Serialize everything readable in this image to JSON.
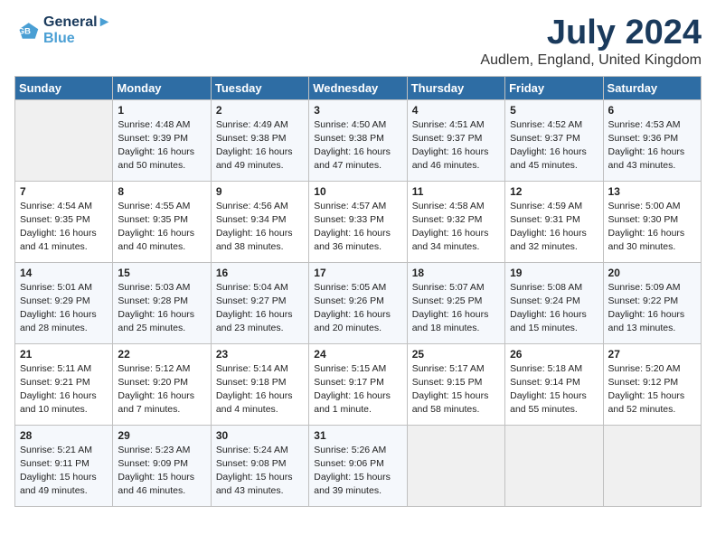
{
  "logo": {
    "line1": "General",
    "line2": "Blue"
  },
  "title": "July 2024",
  "location": "Audlem, England, United Kingdom",
  "days_header": [
    "Sunday",
    "Monday",
    "Tuesday",
    "Wednesday",
    "Thursday",
    "Friday",
    "Saturday"
  ],
  "weeks": [
    [
      {
        "day": "",
        "info": ""
      },
      {
        "day": "1",
        "info": "Sunrise: 4:48 AM\nSunset: 9:39 PM\nDaylight: 16 hours\nand 50 minutes."
      },
      {
        "day": "2",
        "info": "Sunrise: 4:49 AM\nSunset: 9:38 PM\nDaylight: 16 hours\nand 49 minutes."
      },
      {
        "day": "3",
        "info": "Sunrise: 4:50 AM\nSunset: 9:38 PM\nDaylight: 16 hours\nand 47 minutes."
      },
      {
        "day": "4",
        "info": "Sunrise: 4:51 AM\nSunset: 9:37 PM\nDaylight: 16 hours\nand 46 minutes."
      },
      {
        "day": "5",
        "info": "Sunrise: 4:52 AM\nSunset: 9:37 PM\nDaylight: 16 hours\nand 45 minutes."
      },
      {
        "day": "6",
        "info": "Sunrise: 4:53 AM\nSunset: 9:36 PM\nDaylight: 16 hours\nand 43 minutes."
      }
    ],
    [
      {
        "day": "7",
        "info": "Sunrise: 4:54 AM\nSunset: 9:35 PM\nDaylight: 16 hours\nand 41 minutes."
      },
      {
        "day": "8",
        "info": "Sunrise: 4:55 AM\nSunset: 9:35 PM\nDaylight: 16 hours\nand 40 minutes."
      },
      {
        "day": "9",
        "info": "Sunrise: 4:56 AM\nSunset: 9:34 PM\nDaylight: 16 hours\nand 38 minutes."
      },
      {
        "day": "10",
        "info": "Sunrise: 4:57 AM\nSunset: 9:33 PM\nDaylight: 16 hours\nand 36 minutes."
      },
      {
        "day": "11",
        "info": "Sunrise: 4:58 AM\nSunset: 9:32 PM\nDaylight: 16 hours\nand 34 minutes."
      },
      {
        "day": "12",
        "info": "Sunrise: 4:59 AM\nSunset: 9:31 PM\nDaylight: 16 hours\nand 32 minutes."
      },
      {
        "day": "13",
        "info": "Sunrise: 5:00 AM\nSunset: 9:30 PM\nDaylight: 16 hours\nand 30 minutes."
      }
    ],
    [
      {
        "day": "14",
        "info": "Sunrise: 5:01 AM\nSunset: 9:29 PM\nDaylight: 16 hours\nand 28 minutes."
      },
      {
        "day": "15",
        "info": "Sunrise: 5:03 AM\nSunset: 9:28 PM\nDaylight: 16 hours\nand 25 minutes."
      },
      {
        "day": "16",
        "info": "Sunrise: 5:04 AM\nSunset: 9:27 PM\nDaylight: 16 hours\nand 23 minutes."
      },
      {
        "day": "17",
        "info": "Sunrise: 5:05 AM\nSunset: 9:26 PM\nDaylight: 16 hours\nand 20 minutes."
      },
      {
        "day": "18",
        "info": "Sunrise: 5:07 AM\nSunset: 9:25 PM\nDaylight: 16 hours\nand 18 minutes."
      },
      {
        "day": "19",
        "info": "Sunrise: 5:08 AM\nSunset: 9:24 PM\nDaylight: 16 hours\nand 15 minutes."
      },
      {
        "day": "20",
        "info": "Sunrise: 5:09 AM\nSunset: 9:22 PM\nDaylight: 16 hours\nand 13 minutes."
      }
    ],
    [
      {
        "day": "21",
        "info": "Sunrise: 5:11 AM\nSunset: 9:21 PM\nDaylight: 16 hours\nand 10 minutes."
      },
      {
        "day": "22",
        "info": "Sunrise: 5:12 AM\nSunset: 9:20 PM\nDaylight: 16 hours\nand 7 minutes."
      },
      {
        "day": "23",
        "info": "Sunrise: 5:14 AM\nSunset: 9:18 PM\nDaylight: 16 hours\nand 4 minutes."
      },
      {
        "day": "24",
        "info": "Sunrise: 5:15 AM\nSunset: 9:17 PM\nDaylight: 16 hours\nand 1 minute."
      },
      {
        "day": "25",
        "info": "Sunrise: 5:17 AM\nSunset: 9:15 PM\nDaylight: 15 hours\nand 58 minutes."
      },
      {
        "day": "26",
        "info": "Sunrise: 5:18 AM\nSunset: 9:14 PM\nDaylight: 15 hours\nand 55 minutes."
      },
      {
        "day": "27",
        "info": "Sunrise: 5:20 AM\nSunset: 9:12 PM\nDaylight: 15 hours\nand 52 minutes."
      }
    ],
    [
      {
        "day": "28",
        "info": "Sunrise: 5:21 AM\nSunset: 9:11 PM\nDaylight: 15 hours\nand 49 minutes."
      },
      {
        "day": "29",
        "info": "Sunrise: 5:23 AM\nSunset: 9:09 PM\nDaylight: 15 hours\nand 46 minutes."
      },
      {
        "day": "30",
        "info": "Sunrise: 5:24 AM\nSunset: 9:08 PM\nDaylight: 15 hours\nand 43 minutes."
      },
      {
        "day": "31",
        "info": "Sunrise: 5:26 AM\nSunset: 9:06 PM\nDaylight: 15 hours\nand 39 minutes."
      },
      {
        "day": "",
        "info": ""
      },
      {
        "day": "",
        "info": ""
      },
      {
        "day": "",
        "info": ""
      }
    ]
  ]
}
